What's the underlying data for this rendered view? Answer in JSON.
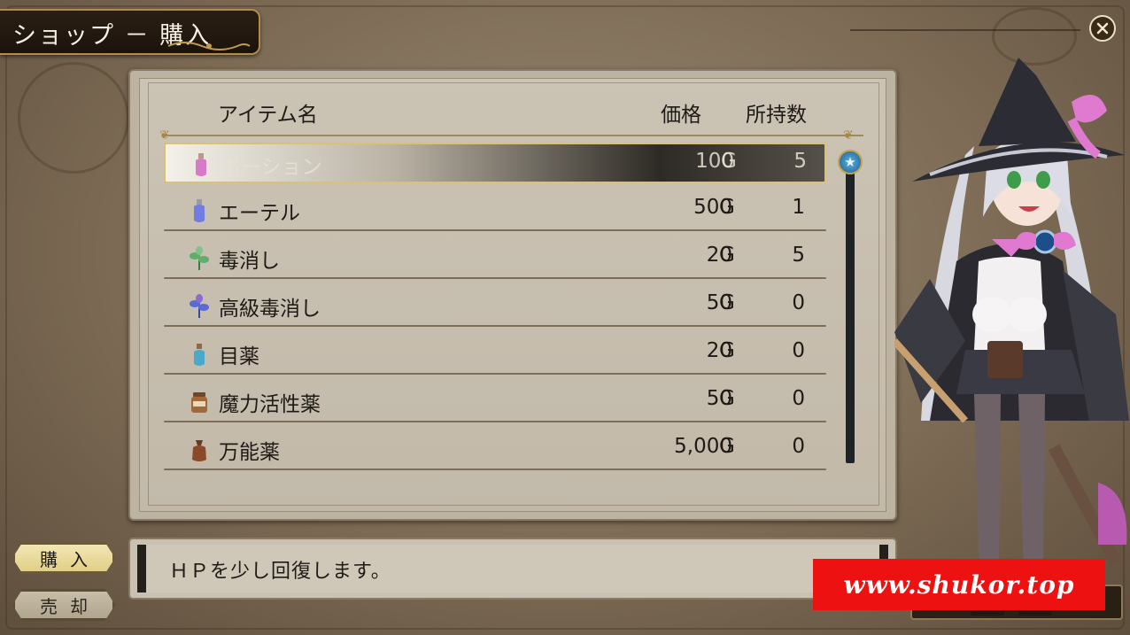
{
  "title": "ショップ － 購入",
  "header": {
    "item_name": "アイテム名",
    "price": "価格",
    "owned": "所持数"
  },
  "items": [
    {
      "name": "ポーション",
      "price": "100",
      "currency": "G",
      "owned": "5",
      "icon": "potion-pink-icon",
      "color": "#d77ac7"
    },
    {
      "name": "エーテル",
      "price": "500",
      "currency": "G",
      "owned": "1",
      "icon": "ether-blue-icon",
      "color": "#6f7ee0"
    },
    {
      "name": "毒消し",
      "price": "20",
      "currency": "G",
      "owned": "5",
      "icon": "herb-green-icon",
      "color": "#5fae6a"
    },
    {
      "name": "高級毒消し",
      "price": "50",
      "currency": "G",
      "owned": "0",
      "icon": "herb-blue-icon",
      "color": "#5a6bd4"
    },
    {
      "name": "目薬",
      "price": "20",
      "currency": "G",
      "owned": "0",
      "icon": "eyedrop-bottle-icon",
      "color": "#4aa8c8"
    },
    {
      "name": "魔力活性薬",
      "price": "50",
      "currency": "G",
      "owned": "0",
      "icon": "jar-icon",
      "color": "#a2683a"
    },
    {
      "name": "万能薬",
      "price": "5,000",
      "currency": "G",
      "owned": "0",
      "icon": "pouch-icon",
      "color": "#8a4a2a"
    }
  ],
  "selected_index": 0,
  "description": "ＨＰを少し回復します。",
  "buttons": {
    "buy": "購入",
    "sell": "売却"
  },
  "watermark": "www.shukor.top",
  "colors": {
    "accent_gold": "#d9c270",
    "watermark_red": "#ee1111",
    "scroll_blue": "#3a8cc4"
  }
}
